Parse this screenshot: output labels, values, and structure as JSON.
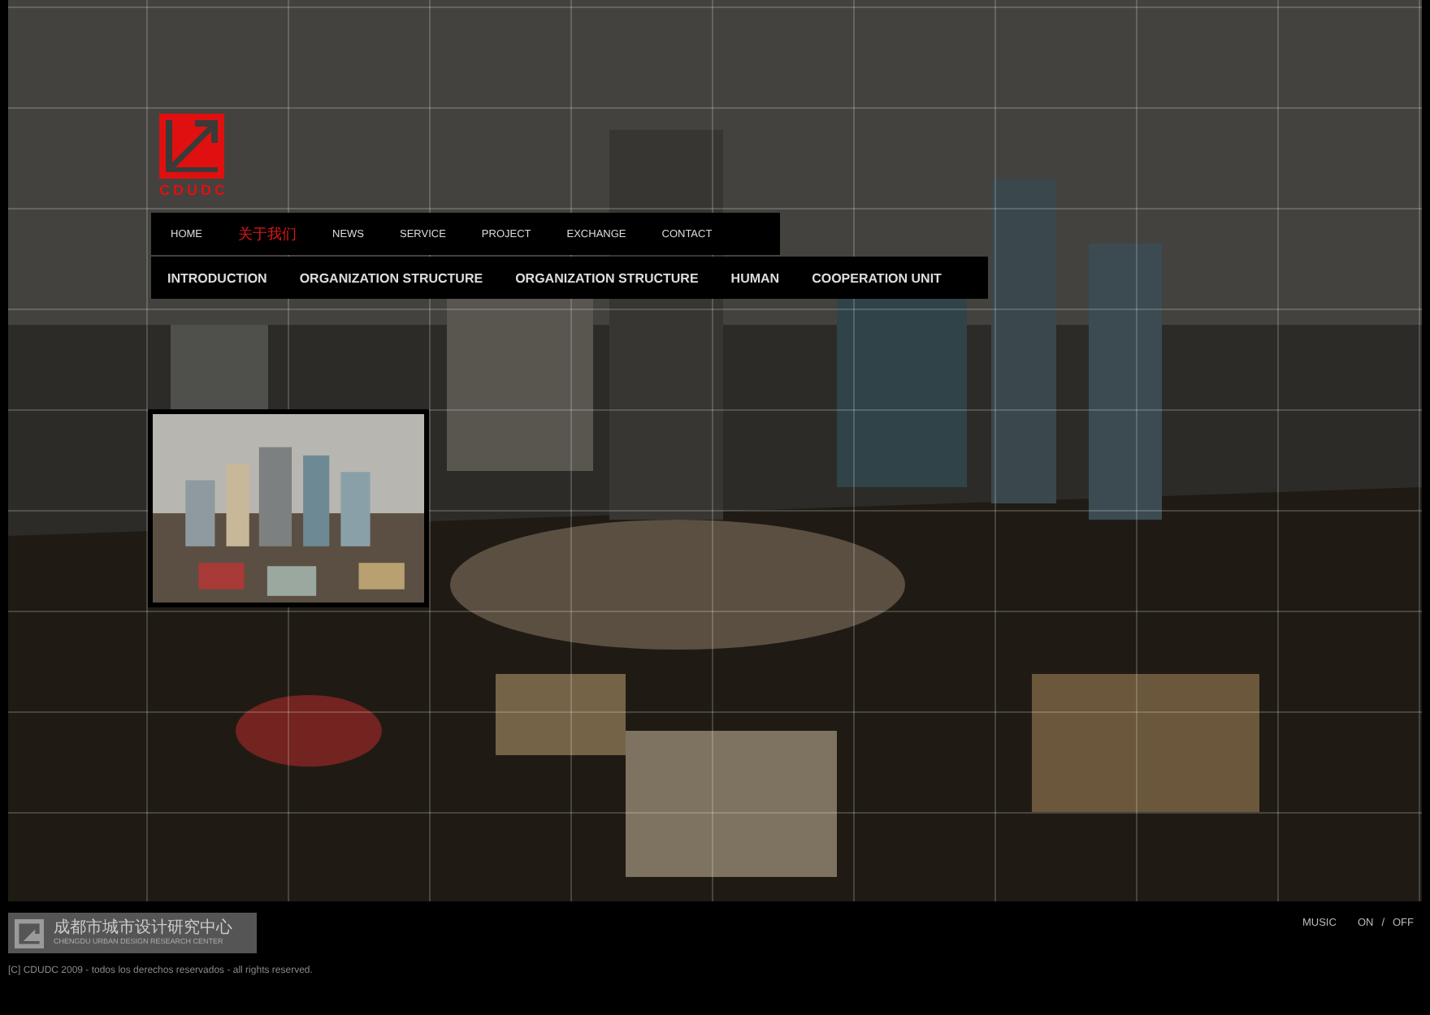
{
  "logo": {
    "text": "CDUDC"
  },
  "nav": [
    {
      "label": "HOME",
      "selected": false
    },
    {
      "label": "关于我们",
      "selected": true
    },
    {
      "label": "NEWS",
      "selected": false
    },
    {
      "label": "SERVICE",
      "selected": false
    },
    {
      "label": "PROJECT",
      "selected": false
    },
    {
      "label": "EXCHANGE",
      "selected": false
    },
    {
      "label": "CONTACT",
      "selected": false
    }
  ],
  "subnav": [
    "INTRODUCTION",
    "ORGANIZATION STRUCTURE",
    "ORGANIZATION STRUCTURE",
    "HUMAN",
    "COOPERATION UNIT"
  ],
  "footer": {
    "name_zh": "成都市城市设计研究中心",
    "name_en": "CHENGDU URBAN DESIGN RESEARCH CENTER",
    "copyright": "[C] CDUDC 2009 - todos los derechos reservados - all rights reserved."
  },
  "music": {
    "label": "MUSIC",
    "on": "ON",
    "separator": "/",
    "off": "OFF"
  }
}
